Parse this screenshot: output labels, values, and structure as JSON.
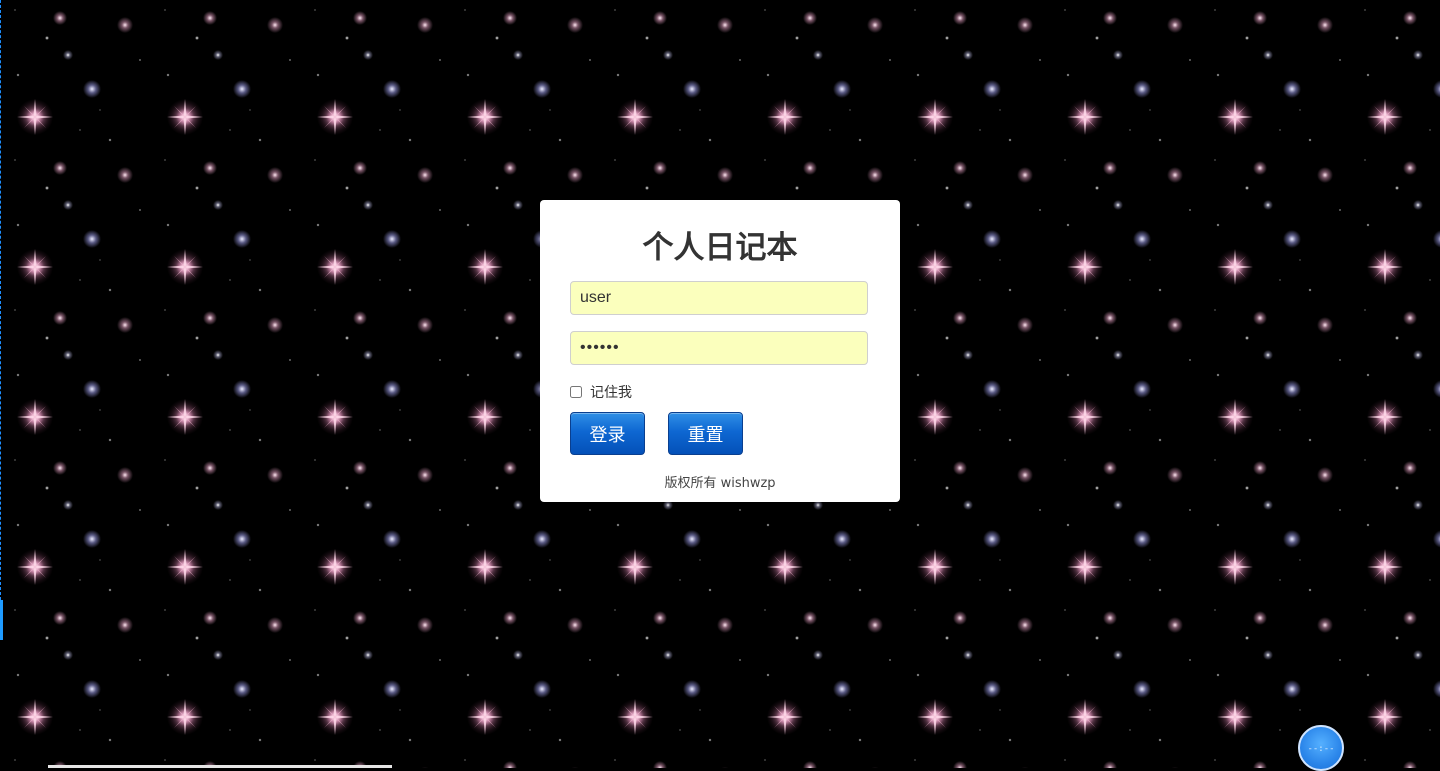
{
  "app": {
    "title": "个人日记本"
  },
  "login": {
    "username_value": "user",
    "password_value": "123456",
    "remember_label": "记住我",
    "login_label": "登录",
    "reset_label": "重置",
    "copyright": "版权所有 wishwzp"
  },
  "widget": {
    "clock_text": "--:--"
  },
  "colors": {
    "background": "#000000",
    "input_bg": "#fbffbd",
    "button": "#0e67d2"
  }
}
